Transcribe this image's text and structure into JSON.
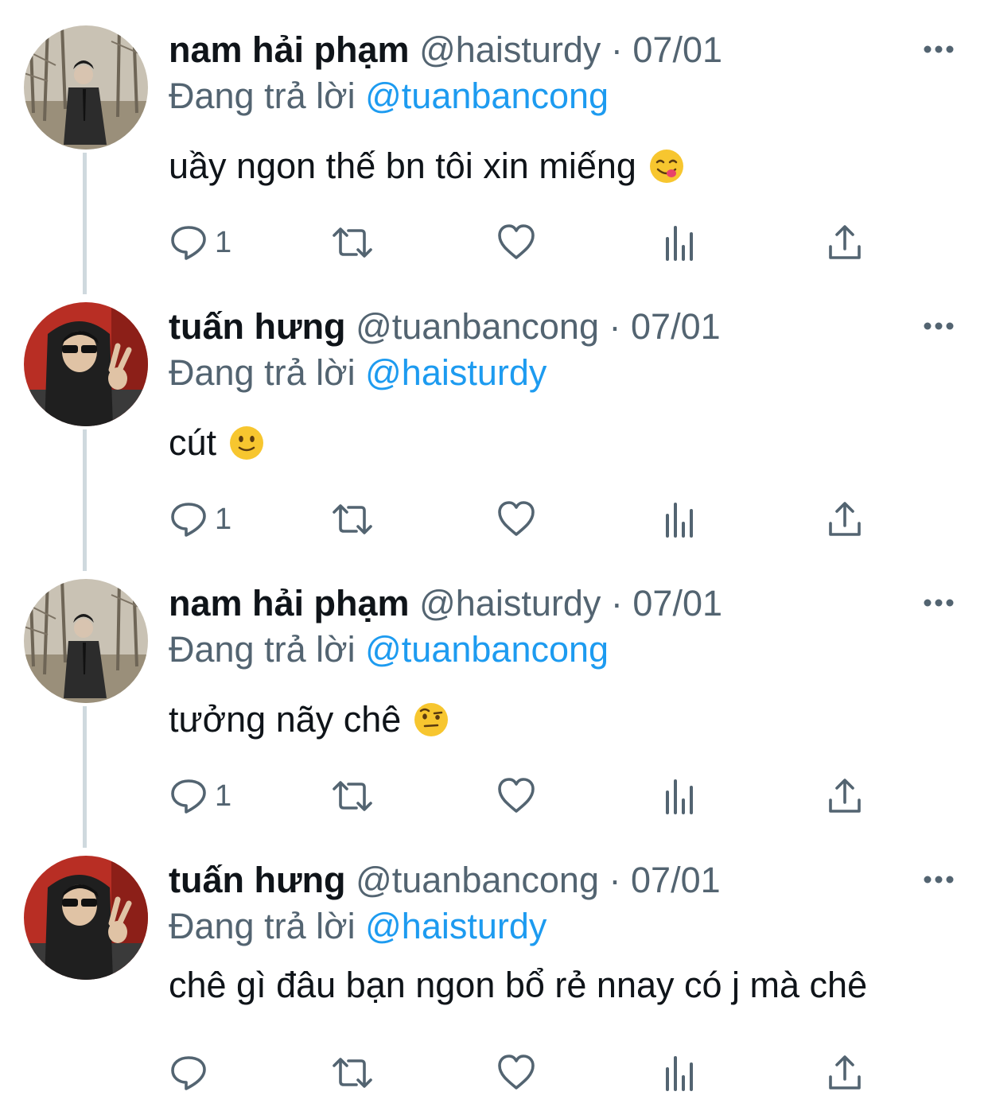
{
  "tweets": [
    {
      "name": "nam hải phạm",
      "handle": "@haisturdy",
      "separator": "·",
      "date": "07/01",
      "replying_prefix": "Đang trả lời",
      "replying_to": "@tuanbancong",
      "text": "uầy ngon thế bn tôi xin miếng",
      "emoji": "yum-face-icon",
      "reply_count": "1"
    },
    {
      "name": "tuấn hưng",
      "handle": "@tuanbancong",
      "separator": "·",
      "date": "07/01",
      "replying_prefix": "Đang trả lời",
      "replying_to": "@haisturdy",
      "text": "cút",
      "emoji": "slightly-smiling-face-icon",
      "reply_count": "1"
    },
    {
      "name": "nam hải phạm",
      "handle": "@haisturdy",
      "separator": "·",
      "date": "07/01",
      "replying_prefix": "Đang trả lời",
      "replying_to": "@tuanbancong",
      "text": "tưởng nãy chê",
      "emoji": "raised-eyebrow-face-icon",
      "reply_count": "1"
    },
    {
      "name": "tuấn hưng",
      "handle": "@tuanbancong",
      "separator": "·",
      "date": "07/01",
      "replying_prefix": "Đang trả lời",
      "replying_to": "@haisturdy",
      "text": "chê gì đâu bạn ngon bổ rẻ nnay có j mà chê",
      "emoji": "",
      "reply_count": ""
    }
  ],
  "icons": {
    "reply": "reply-icon",
    "retweet": "retweet-icon",
    "like": "heart-icon",
    "views": "views-chart-icon",
    "share": "share-icon",
    "more": "more-options-icon"
  },
  "colors": {
    "name": "#0f1419",
    "secondary": "#536471",
    "link": "#1d9bf0",
    "thread_line": "#cfd9de"
  }
}
